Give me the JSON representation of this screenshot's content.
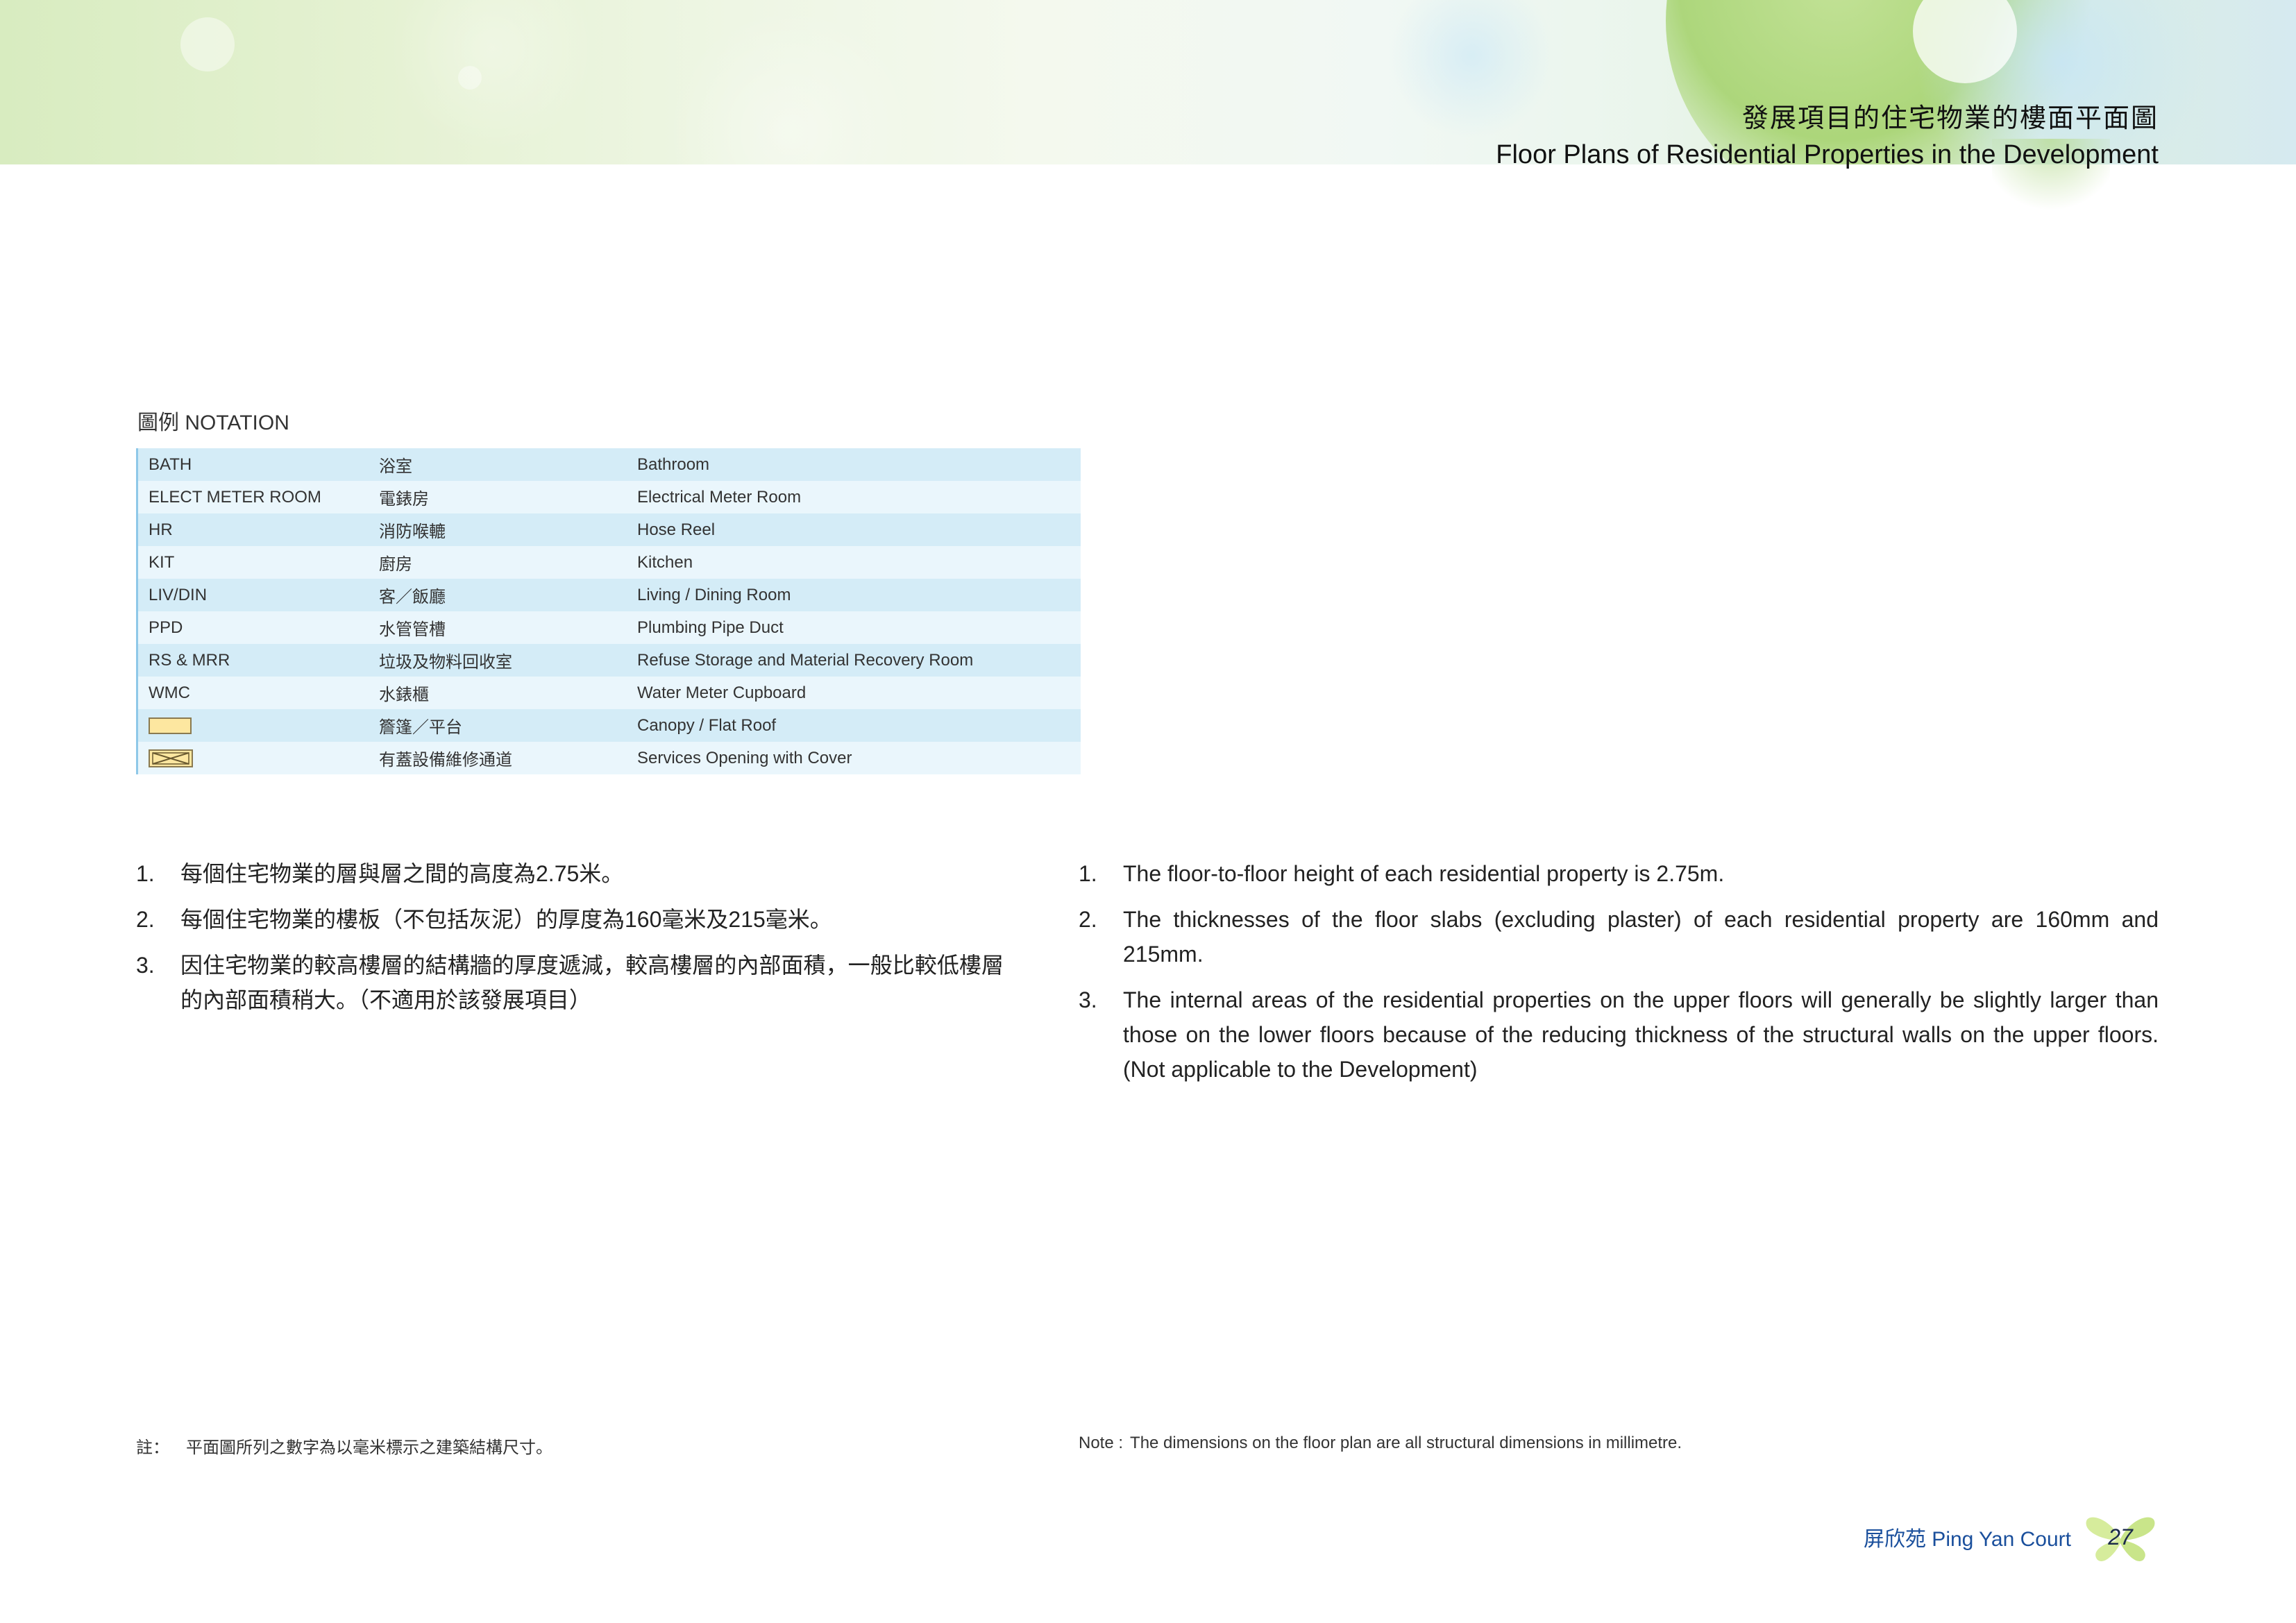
{
  "header": {
    "title_zh": "發展項目的住宅物業的樓面平面圖",
    "title_en": "Floor Plans of Residential Properties in the Development"
  },
  "notation": {
    "title": "圖例 NOTATION",
    "rows": [
      {
        "code": "BATH",
        "zh": "浴室",
        "en": "Bathroom"
      },
      {
        "code": "ELECT METER ROOM",
        "zh": "電錶房",
        "en": "Electrical Meter Room"
      },
      {
        "code": "HR",
        "zh": "消防喉轆",
        "en": "Hose Reel"
      },
      {
        "code": "KIT",
        "zh": "廚房",
        "en": "Kitchen"
      },
      {
        "code": "LIV/DIN",
        "zh": "客／飯廳",
        "en": "Living / Dining Room"
      },
      {
        "code": "PPD",
        "zh": "水管管槽",
        "en": "Plumbing Pipe Duct"
      },
      {
        "code": "RS & MRR",
        "zh": "垃圾及物料回收室",
        "en": "Refuse Storage and Material Recovery Room"
      },
      {
        "code": "WMC",
        "zh": "水錶櫃",
        "en": "Water Meter Cupboard"
      },
      {
        "code": "",
        "zh": "簷篷／平台",
        "en": "Canopy / Flat Roof",
        "symbol": "canopy-swatch"
      },
      {
        "code": "",
        "zh": "有蓋設備維修通道",
        "en": "Services Opening with Cover",
        "symbol": "cover-swatch"
      }
    ]
  },
  "notes_zh": [
    {
      "num": "1.",
      "text": "每個住宅物業的層與層之間的高度為2.75米。"
    },
    {
      "num": "2.",
      "text": "每個住宅物業的樓板（不包括灰泥）的厚度為160毫米及215毫米。"
    },
    {
      "num": "3.",
      "text": "因住宅物業的較高樓層的結構牆的厚度遞減，較高樓層的內部面積，一般比較低樓層的內部面積稍大。（不適用於該發展項目）"
    }
  ],
  "notes_en": [
    {
      "num": "1.",
      "text": "The floor-to-floor height of each residential property is 2.75m."
    },
    {
      "num": "2.",
      "text": "The thicknesses of the floor slabs (excluding plaster) of each residential property are 160mm and 215mm."
    },
    {
      "num": "3.",
      "text": "The internal areas of the residential properties on the upper floors will generally be slightly larger than those on the lower floors because of the reducing thickness of the structural walls on the upper floors. (Not applicable to the Development)"
    }
  ],
  "footnote_zh": {
    "label": "註：",
    "text": "平面圖所列之數字為以毫米標示之建築結構尺寸。"
  },
  "footnote_en": {
    "label": "Note :",
    "text": "The dimensions on the floor plan are all structural dimensions in millimetre."
  },
  "footer": {
    "name": "屏欣苑  Ping Yan Court",
    "page": "27"
  },
  "colors": {
    "banner_green": "#a6d36f",
    "table_row_dark": "#d4ecf7",
    "table_row_light": "#eaf6fc",
    "footer_blue": "#1a4f9c",
    "butterfly": "#d6ec9c"
  }
}
